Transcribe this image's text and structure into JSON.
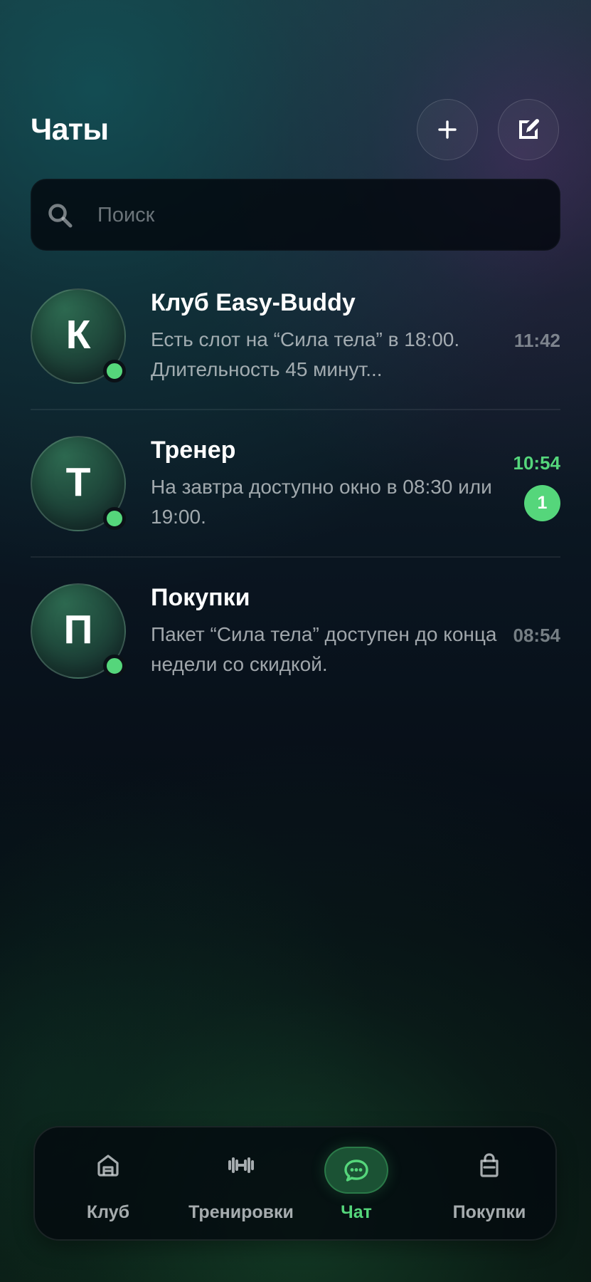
{
  "page": {
    "title": "Чаты"
  },
  "header": {
    "buttons": [
      {
        "name": "new-chat-button",
        "icon": "plus-icon"
      },
      {
        "name": "compose-button",
        "icon": "compose-icon"
      }
    ]
  },
  "search": {
    "icon": "search-icon",
    "placeholder": "Поиск",
    "value": ""
  },
  "chats": [
    {
      "avatar_letter": "К",
      "name": "Клуб Easy-Buddy",
      "preview": "Есть слот на “Сила тела” в 18:00. Длительность 45 минут...",
      "time": "11:42",
      "unread_count": "",
      "online": true
    },
    {
      "avatar_letter": "Т",
      "name": "Тренер",
      "preview": "На завтра доступно окно в 08:30 или 19:00.",
      "time": "10:54",
      "unread_count": "1",
      "online": true
    },
    {
      "avatar_letter": "П",
      "name": "Покупки",
      "preview": "Пакет “Сила тела” доступен до конца недели со скидкой.",
      "time": "08:54",
      "unread_count": "",
      "online": true
    }
  ],
  "tabs": [
    {
      "label": "Клуб",
      "icon": "club-icon",
      "active": false
    },
    {
      "label": "Тренировки",
      "icon": "dumbbell-icon",
      "active": false
    },
    {
      "label": "Чат",
      "icon": "chat-icon",
      "active": true
    },
    {
      "label": "Покупки",
      "icon": "shopping-bag-icon",
      "active": false
    }
  ],
  "colors": {
    "accent": "#55d67b",
    "background_dark": "#060b12",
    "text_primary": "#ffffff",
    "text_secondary": "#d3d8db"
  }
}
